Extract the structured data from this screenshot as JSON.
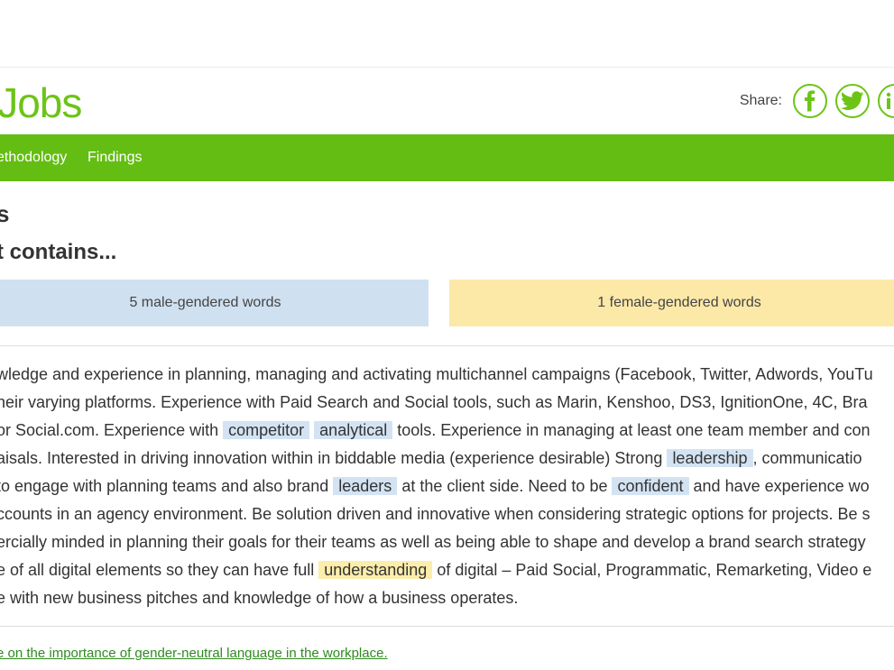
{
  "header": {
    "logo_text": "lJobs",
    "share_label": "Share:",
    "social_icons": [
      "facebook-icon",
      "twitter-icon",
      "linkedin-icon"
    ]
  },
  "nav": {
    "items": [
      "ethodology",
      "Findings"
    ]
  },
  "headings": {
    "title": "s",
    "subtitle": "t contains..."
  },
  "summary": {
    "male_label": "5 male-gendered words",
    "female_label": "1 female-gendered words"
  },
  "job_text": {
    "lines": [
      [
        {
          "t": "wledge and experience in planning, managing and activating multichannel campaigns (Facebook, Twitter, Adwords, YouTu"
        }
      ],
      [
        {
          "t": "heir varying platforms. Experience with Paid Search and Social tools, such as Marin, Kenshoo, DS3, IgnitionOne, 4C, Bra"
        }
      ],
      [
        {
          "t": "or Social.com. Experience with "
        },
        {
          "t": "competitor",
          "h": "m"
        },
        {
          "t": " "
        },
        {
          "t": "analytical",
          "h": "m"
        },
        {
          "t": " tools. Experience in managing at least one team member and con"
        }
      ],
      [
        {
          "t": "aisals. Interested in driving innovation within in biddable media (experience desirable) Strong "
        },
        {
          "t": "leadership",
          "h": "m"
        },
        {
          "t": ", communicatio"
        }
      ],
      [
        {
          "t": " to engage with planning teams and also brand "
        },
        {
          "t": "leaders",
          "h": "m"
        },
        {
          "t": " at the client side. Need to be "
        },
        {
          "t": "confident",
          "h": "m"
        },
        {
          "t": " and have experience wo"
        }
      ],
      [
        {
          "t": "ccounts in an agency environment. Be solution driven and innovative when considering strategic options for projects. Be s"
        }
      ],
      [
        {
          "t": "ercially minded in planning their goals for their teams as well as being able to shape and develop a brand search strategy"
        }
      ],
      [
        {
          "t": "e of all digital elements so they can have full "
        },
        {
          "t": "understanding",
          "h": "f"
        },
        {
          "t": " of digital – Paid Social, Programmatic, Remarketing, Video e"
        }
      ],
      [
        {
          "t": "e with new business pitches and knowledge of how a business operates."
        }
      ]
    ]
  },
  "footer": {
    "link_text": "e on the importance of gender-neutral language in the workplace."
  },
  "colors": {
    "brand_green": "#64bd13",
    "male_highlight": "#cfe0f0",
    "female_highlight": "#fce9a8"
  }
}
